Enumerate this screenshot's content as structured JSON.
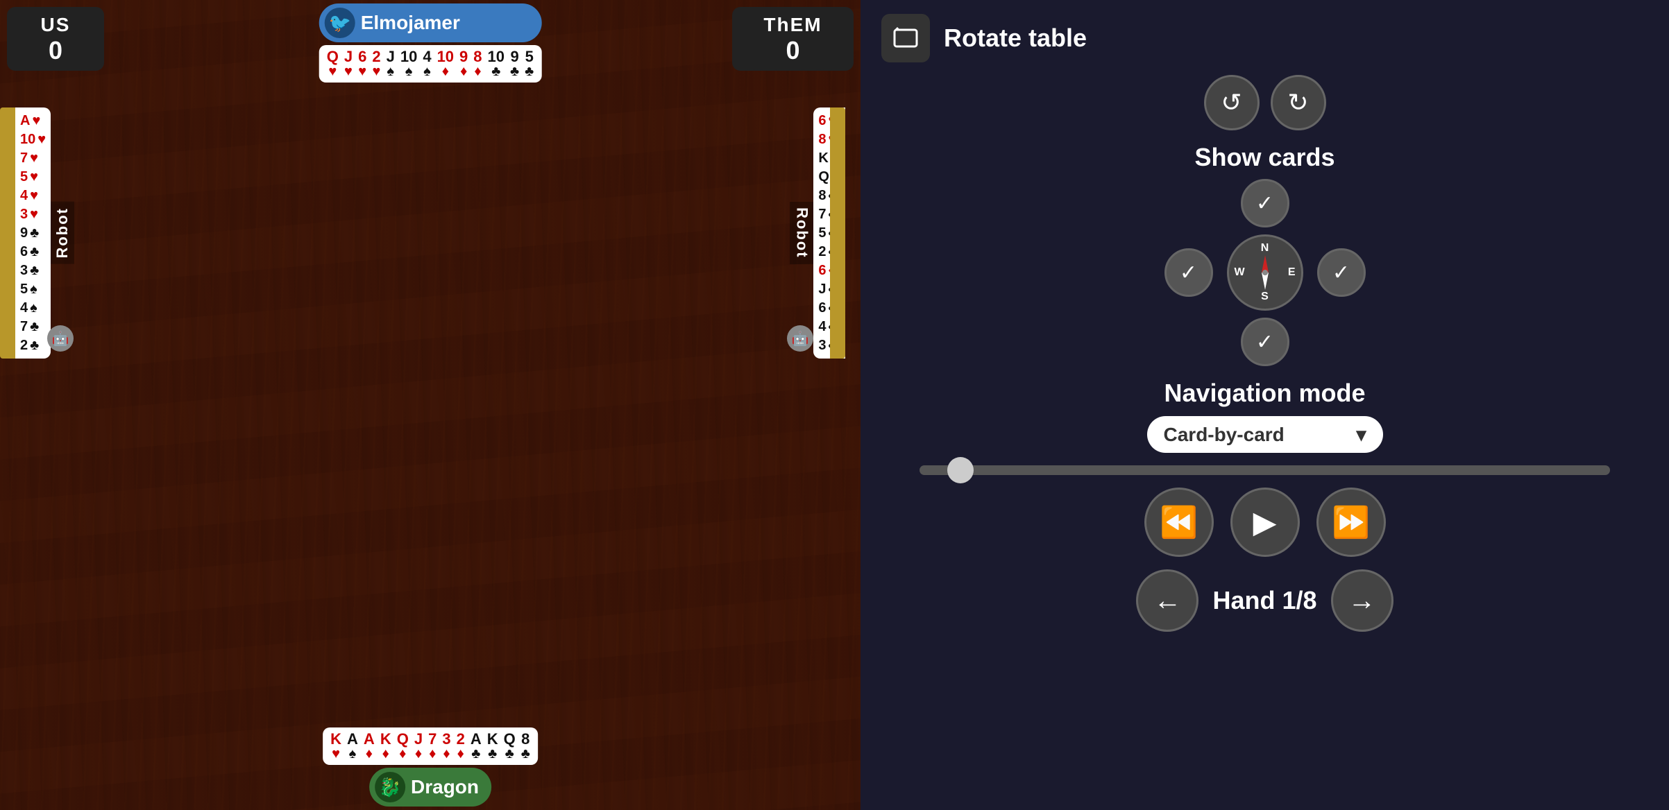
{
  "scores": {
    "us_label": "US",
    "us_value": "0",
    "them_label": "ThEM",
    "them_value": "0"
  },
  "top_player": {
    "name": "Elmojamer",
    "avatar_icon": "🐦",
    "cards": [
      {
        "rank": "Q",
        "suit": "♥",
        "color": "red"
      },
      {
        "rank": "J",
        "suit": "♥",
        "color": "red"
      },
      {
        "rank": "6",
        "suit": "♥",
        "color": "red"
      },
      {
        "rank": "2",
        "suit": "♥",
        "color": "red"
      },
      {
        "rank": "J",
        "suit": "♠",
        "color": "black"
      },
      {
        "rank": "10",
        "suit": "♠",
        "color": "black"
      },
      {
        "rank": "4",
        "suit": "♠",
        "color": "black"
      },
      {
        "rank": "10",
        "suit": "♦",
        "color": "red"
      },
      {
        "rank": "9",
        "suit": "♦",
        "color": "red"
      },
      {
        "rank": "8",
        "suit": "♦",
        "color": "red"
      },
      {
        "rank": "10",
        "suit": "♣",
        "color": "black"
      },
      {
        "rank": "9",
        "suit": "♣",
        "color": "black"
      },
      {
        "rank": "5",
        "suit": "♣",
        "color": "black"
      }
    ]
  },
  "left_player": {
    "name": "Robot",
    "is_robot": true,
    "cards": [
      {
        "rank": "A",
        "suit": "♥",
        "color": "red"
      },
      {
        "rank": "10",
        "suit": "♥",
        "color": "red"
      },
      {
        "rank": "7",
        "suit": "♥",
        "color": "red"
      },
      {
        "rank": "5",
        "suit": "♥",
        "color": "red"
      },
      {
        "rank": "4",
        "suit": "♥",
        "color": "red"
      },
      {
        "rank": "3",
        "suit": "♥",
        "color": "red"
      },
      {
        "rank": "9",
        "suit": "♣",
        "color": "black"
      },
      {
        "rank": "6",
        "suit": "♣",
        "color": "black"
      },
      {
        "rank": "3",
        "suit": "♣",
        "color": "black"
      },
      {
        "rank": "5",
        "suit": "♠",
        "color": "black"
      },
      {
        "rank": "4",
        "suit": "♠",
        "color": "black"
      },
      {
        "rank": "7",
        "suit": "♣",
        "color": "black"
      },
      {
        "rank": "2",
        "suit": "♣",
        "color": "black"
      }
    ]
  },
  "right_player": {
    "name": "Robot",
    "is_robot": true,
    "cards": [
      {
        "rank": "6",
        "suit": "♥",
        "color": "red"
      },
      {
        "rank": "8",
        "suit": "♥",
        "color": "red"
      },
      {
        "rank": "K",
        "suit": "♣",
        "color": "black"
      },
      {
        "rank": "Q",
        "suit": "♣",
        "color": "black"
      },
      {
        "rank": "8",
        "suit": "♣",
        "color": "black"
      },
      {
        "rank": "7",
        "suit": "♣",
        "color": "black"
      },
      {
        "rank": "5",
        "suit": "♣",
        "color": "black"
      },
      {
        "rank": "2",
        "suit": "♣",
        "color": "black"
      },
      {
        "rank": "6",
        "suit": "♦",
        "color": "red"
      },
      {
        "rank": "J",
        "suit": "♣",
        "color": "black"
      },
      {
        "rank": "6",
        "suit": "♣",
        "color": "black"
      },
      {
        "rank": "4",
        "suit": "♣",
        "color": "black"
      },
      {
        "rank": "3",
        "suit": "♣",
        "color": "black"
      }
    ]
  },
  "bottom_player": {
    "name": "Dragon",
    "avatar_icon": "🐉",
    "cards": [
      {
        "rank": "K",
        "suit": "♥",
        "color": "red"
      },
      {
        "rank": "A",
        "suit": "♠",
        "color": "black"
      },
      {
        "rank": "A",
        "suit": "♦",
        "color": "red"
      },
      {
        "rank": "K",
        "suit": "♦",
        "color": "red"
      },
      {
        "rank": "Q",
        "suit": "♦",
        "color": "red"
      },
      {
        "rank": "J",
        "suit": "♦",
        "color": "red"
      },
      {
        "rank": "7",
        "suit": "♦",
        "color": "red"
      },
      {
        "rank": "3",
        "suit": "♦",
        "color": "red"
      },
      {
        "rank": "2",
        "suit": "♦",
        "color": "red"
      },
      {
        "rank": "A",
        "suit": "♣",
        "color": "black"
      },
      {
        "rank": "K",
        "suit": "♣",
        "color": "black"
      },
      {
        "rank": "Q",
        "suit": "♣",
        "color": "black"
      },
      {
        "rank": "8",
        "suit": "♣",
        "color": "black"
      }
    ]
  },
  "right_panel": {
    "rotate_table_label": "Rotate table",
    "show_cards_label": "Show cards",
    "navigation_mode_label": "Navigation mode",
    "navigation_mode_value": "Card-by-card",
    "hand_label": "Hand 1/8",
    "rotate_ccw_icon": "↺",
    "rotate_cw_icon": "↻",
    "rewind_icon": "⏪",
    "play_icon": "▶",
    "fast_forward_icon": "⏩",
    "prev_hand_icon": "←",
    "next_hand_icon": "→",
    "dropdown_arrow": "▾",
    "check_icon": "✓"
  }
}
